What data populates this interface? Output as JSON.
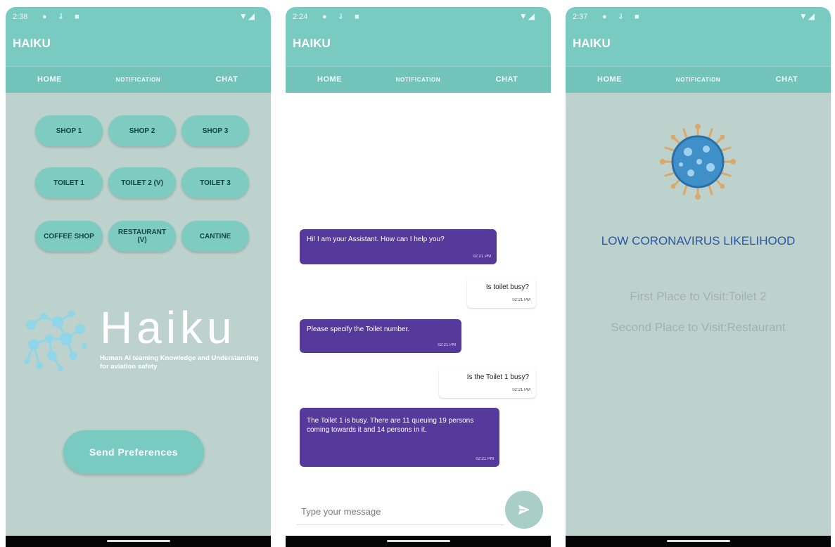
{
  "app": {
    "title": "HAIKU",
    "accent": "#79cac1",
    "bot_bubble": "#563a9b"
  },
  "screens": {
    "home": {
      "status_time": "2:38",
      "tabs": [
        "HOME",
        "NOTIFICATION",
        "CHAT"
      ],
      "active_tab": "HOME",
      "places": [
        [
          "SHOP 1",
          "SHOP 2",
          "SHOP 3"
        ],
        [
          "TOILET 1",
          "TOILET 2 (V)",
          "TOILET 3"
        ],
        [
          "COFFEE SHOP",
          "RESTAURANT (V)",
          "CANTINE"
        ]
      ],
      "logo_word": "Haiku",
      "logo_tagline": "Human AI teaming Knowledge and Understanding for aviation safety",
      "send_button": "Send Preferences"
    },
    "chat": {
      "status_time": "2:24",
      "tabs": [
        "HOME",
        "NOTIFICATION",
        "CHAT"
      ],
      "active_tab": "CHAT",
      "messages": [
        {
          "from": "bot",
          "text": "Hi! I am your Assistant. How can I help you?",
          "time": "02:21 PM"
        },
        {
          "from": "user",
          "text": "Is toilet busy?",
          "time": "02:21 PM"
        },
        {
          "from": "bot",
          "text": "Please specify the Toilet number.",
          "time": "02:21 PM"
        },
        {
          "from": "user",
          "text": "Is the Toilet 1 busy?",
          "time": "02:21 PM"
        },
        {
          "from": "bot",
          "text": "The Toilet 1 is busy. There are 11 queuing 19 persons coming towards it and 14 persons in it.",
          "time": "02:21 PM"
        }
      ],
      "input_placeholder": "Type your message"
    },
    "notification": {
      "status_time": "2:37",
      "tabs": [
        "HOME",
        "NOTIFICATION",
        "CHAT"
      ],
      "active_tab": "NOTIFICATION",
      "likelihood": "LOW CORONAVIRUS LIKELIHOOD",
      "first_place": "First Place to Visit:Toilet 2",
      "second_place": "Second Place to Visit:Restaurant"
    }
  }
}
